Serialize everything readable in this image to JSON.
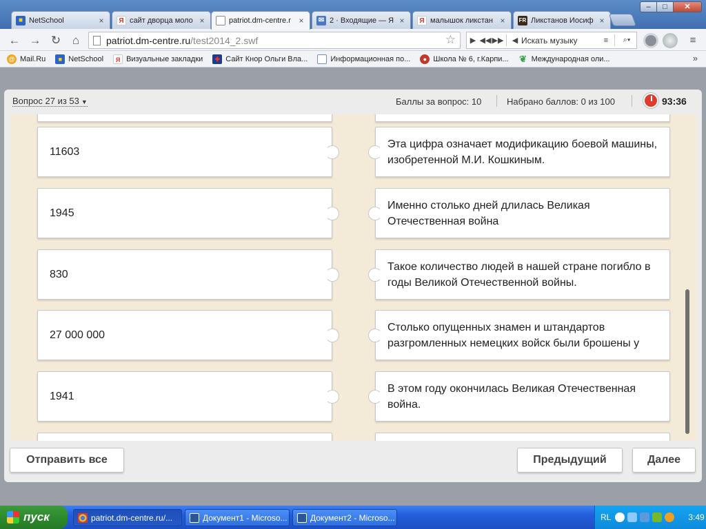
{
  "browser": {
    "tabs": [
      {
        "title": "NetSchool",
        "icon": "netschool-icon",
        "color": "#2b63c6"
      },
      {
        "title": "сайт дворца моло",
        "icon": "yandex-icon",
        "color": "#d83a2b"
      },
      {
        "title": "patriot.dm-centre.r",
        "icon": "page-icon",
        "color": "#888888",
        "active": true
      },
      {
        "title": "2 · Входящие — Я",
        "icon": "mail-icon",
        "color": "#4a78c8"
      },
      {
        "title": "малышок ликстан",
        "icon": "yandex-icon",
        "color": "#d83a2b"
      },
      {
        "title": "Ликстанов Иосиф",
        "icon": "fr-icon",
        "color": "#3b2a1a"
      }
    ],
    "window": {
      "minimize": "‒",
      "maximize": "□",
      "close": "✕"
    },
    "url_host": "patriot.dm-centre.ru",
    "url_path": "/test2014_2.swf",
    "music": {
      "label": "Искать музыку"
    },
    "bookmarks": [
      {
        "title": "Mail.Ru",
        "icon": "mailru-icon",
        "color": "#f5a623"
      },
      {
        "title": "NetSchool",
        "icon": "netschool-icon",
        "color": "#2b63c6"
      },
      {
        "title": "Визуальные закладки",
        "icon": "yandex-icon",
        "color": "#d83a2b"
      },
      {
        "title": "Сайт Кнор Ольги Вла...",
        "icon": "uk-flag-icon",
        "color": "#1f3c88"
      },
      {
        "title": "Информационная по...",
        "icon": "page-icon",
        "color": "#6a8fd0"
      },
      {
        "title": "Школа № 6, г.Карпи...",
        "icon": "school-icon",
        "color": "#c0392b"
      },
      {
        "title": "Международная оли...",
        "icon": "leaf-icon",
        "color": "#3aa34a"
      }
    ],
    "bookmarks_more": "»"
  },
  "quiz": {
    "question_label": "Вопрос 27 из 53",
    "points_per_question": "Баллы за вопрос: 10",
    "score_total": "Набрано баллов: 0 из 100",
    "timer": "93:36",
    "left_items": [
      "11603",
      "1945",
      "830",
      "27 000 000",
      "1941"
    ],
    "right_items": [
      "Эта цифра означает модификацию боевой машины, изобретенной М.И. Кошкиным.",
      "Именно столько дней длилась Великая Отечественная война",
      "Такое количество людей в нашей стране погибло в годы Великой Отечественной войны.",
      "Столько опущенных знамен и штандартов разгромленных немецких войск были брошены у",
      "В этом году окончилась Великая Отечественная война."
    ],
    "buttons": {
      "submit_all": "Отправить все",
      "previous": "Предыдущий",
      "next": "Далее"
    }
  },
  "taskbar": {
    "start_label": "пуск",
    "tasks": [
      {
        "title": "patriot.dm-centre.ru/...",
        "icon": "chrome-icon",
        "color": "#e8b923",
        "active": true
      },
      {
        "title": "Документ1 - Microso...",
        "icon": "word-icon",
        "color": "#2a5699"
      },
      {
        "title": "Документ2 - Microso...",
        "icon": "word-icon",
        "color": "#2a5699"
      }
    ],
    "lang": "RL",
    "clock": "3:49"
  }
}
